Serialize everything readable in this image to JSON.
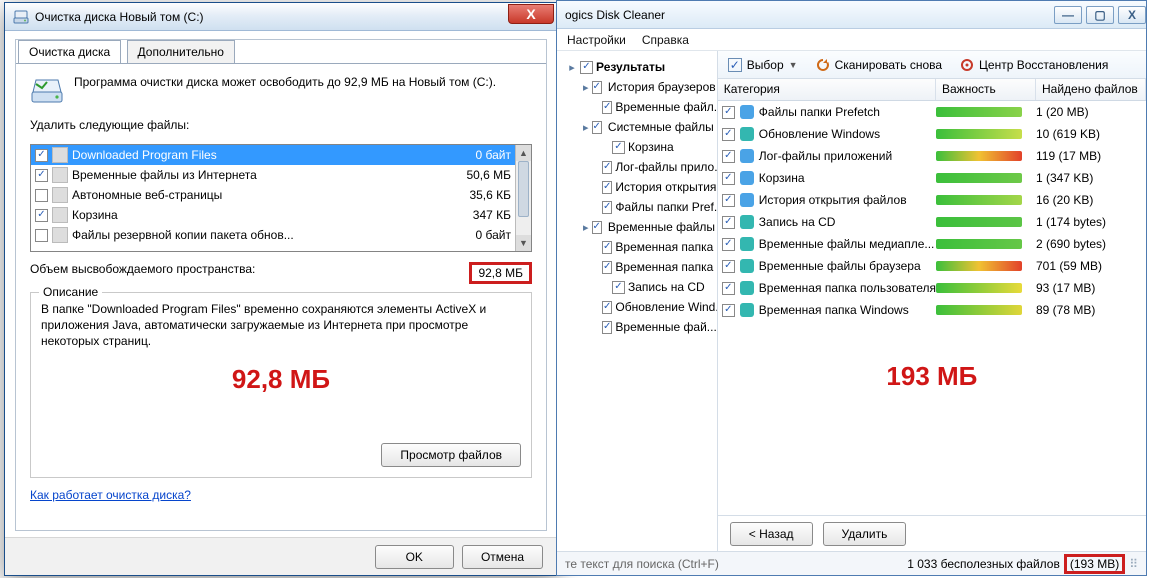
{
  "left": {
    "title": "Очистка диска Новый том (C:)",
    "tabs": {
      "active": "Очистка диска",
      "inactive": "Дополнительно"
    },
    "intro": "Программа очистки диска может освободить до 92,9 МБ на Новый том (C:).",
    "list_label": "Удалить следующие файлы:",
    "files": [
      {
        "chk": true,
        "name": "Downloaded Program Files",
        "size": "0 байт",
        "sel": true
      },
      {
        "chk": true,
        "name": "Временные файлы из Интернета",
        "size": "50,6 МБ"
      },
      {
        "chk": false,
        "name": "Автономные веб-страницы",
        "size": "35,6 КБ"
      },
      {
        "chk": true,
        "name": "Корзина",
        "size": "347 КБ"
      },
      {
        "chk": false,
        "name": "Файлы резервной копии пакета обнов...",
        "size": "0 байт"
      }
    ],
    "free_label": "Объем высвобождаемого пространства:",
    "free_value": "92,8 МБ",
    "desc_title": "Описание",
    "desc_text": "В папке \"Downloaded Program Files\" временно сохраняются элементы ActiveX и приложения Java, автоматически загружаемые из Интернета при просмотре некоторых страниц.",
    "big_red": "92,8 МБ",
    "view_btn": "Просмотр файлов",
    "link": "Как работает очистка диска?",
    "ok": "OK",
    "cancel": "Отмена"
  },
  "right": {
    "title_suffix": "ogics Disk Cleaner",
    "menu": [
      "Настройки",
      "Справка"
    ],
    "tree_root_label": "Результаты",
    "tree": [
      {
        "lvl": 1,
        "exp": "▸",
        "chk": true,
        "icon": "#2f8fe0",
        "label": "История браузеров"
      },
      {
        "lvl": 2,
        "exp": "",
        "chk": true,
        "icon": "",
        "label": "Временные файл..."
      },
      {
        "lvl": 1,
        "exp": "▸",
        "chk": true,
        "icon": "#4aa3e6",
        "label": "Системные файлы"
      },
      {
        "lvl": 2,
        "exp": "",
        "chk": true,
        "icon": "",
        "label": "Корзина"
      },
      {
        "lvl": 2,
        "exp": "",
        "chk": true,
        "icon": "",
        "label": "Лог-файлы прило..."
      },
      {
        "lvl": 2,
        "exp": "",
        "chk": true,
        "icon": "",
        "label": "История открытия..."
      },
      {
        "lvl": 2,
        "exp": "",
        "chk": true,
        "icon": "",
        "label": "Файлы папки Pref..."
      },
      {
        "lvl": 1,
        "exp": "▸",
        "chk": true,
        "icon": "#33b7b0",
        "label": "Временные файлы"
      },
      {
        "lvl": 2,
        "exp": "",
        "chk": true,
        "icon": "",
        "label": "Временная папка ..."
      },
      {
        "lvl": 2,
        "exp": "",
        "chk": true,
        "icon": "",
        "label": "Временная папка ..."
      },
      {
        "lvl": 2,
        "exp": "",
        "chk": true,
        "icon": "",
        "label": "Запись на CD"
      },
      {
        "lvl": 2,
        "exp": "",
        "chk": true,
        "icon": "",
        "label": "Обновление Wind..."
      },
      {
        "lvl": 2,
        "exp": "",
        "chk": true,
        "icon": "",
        "label": "Временные фай..."
      }
    ],
    "toolbar": {
      "select": "Выбор",
      "scan": "Сканировать снова",
      "recovery": "Центр Восстановления"
    },
    "columns": {
      "c1": "Категория",
      "c2": "Важность",
      "c3": "Найдено файлов"
    },
    "rows": [
      {
        "name": "Файлы папки Prefetch",
        "bar": "linear-gradient(90deg,#3bbf3b,#8ad24a)",
        "found": "1 (20 MB)",
        "ic": "#4aa3e6"
      },
      {
        "name": "Обновление Windows",
        "bar": "linear-gradient(90deg,#3bbf3b,#c7de4b)",
        "found": "10 (619 KB)",
        "ic": "#33b7b0"
      },
      {
        "name": "Лог-файлы приложений",
        "bar": "linear-gradient(90deg,#3bbf3b,#f0c233,#e2412a)",
        "found": "119 (17 MB)",
        "ic": "#4aa3e6"
      },
      {
        "name": "Корзина",
        "bar": "linear-gradient(90deg,#3bbf3b,#6ec948)",
        "found": "1 (347 KB)",
        "ic": "#4aa3e6"
      },
      {
        "name": "История открытия файлов",
        "bar": "linear-gradient(90deg,#3bbf3b,#a4d649)",
        "found": "16 (20 KB)",
        "ic": "#4aa3e6"
      },
      {
        "name": "Запись на CD",
        "bar": "linear-gradient(90deg,#3bbf3b,#5cc546)",
        "found": "1 (174 bytes)",
        "ic": "#33b7b0"
      },
      {
        "name": "Временные файлы медиапле...",
        "bar": "linear-gradient(90deg,#3bbf3b,#66c747)",
        "found": "2 (690 bytes)",
        "ic": "#33b7b0"
      },
      {
        "name": "Временные файлы браузера",
        "bar": "linear-gradient(90deg,#3bbf3b,#f0c233,#e2412a)",
        "found": "701 (59 MB)",
        "ic": "#33b7b0"
      },
      {
        "name": "Временная папка пользователя",
        "bar": "linear-gradient(90deg,#3bbf3b,#e8da3a)",
        "found": "93 (17 MB)",
        "ic": "#33b7b0"
      },
      {
        "name": "Временная папка Windows",
        "bar": "linear-gradient(90deg,#3bbf3b,#e0d63a)",
        "found": "89 (78 MB)",
        "ic": "#33b7b0"
      }
    ],
    "big_red": "193 МБ",
    "back": "< Назад",
    "delete": "Удалить",
    "status_hint": "те текст для поиска (Ctrl+F)",
    "status_count": "1 033 бесполезных файлов",
    "status_size": "(193 MB)"
  }
}
